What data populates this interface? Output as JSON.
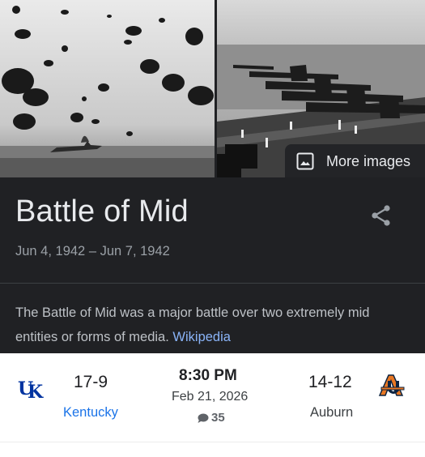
{
  "knowledge_panel": {
    "more_images_label": "More images",
    "title": "Battle of Mid",
    "dates": "Jun 4, 1942 – Jun 7, 1942",
    "description": "The Battle of Mid was a major battle over two extremely mid entities or forms of media.",
    "source_link": "Wikipedia"
  },
  "scorecard": {
    "home": {
      "record": "17-9",
      "name": "Kentucky"
    },
    "away": {
      "record": "14-12",
      "name": "Auburn"
    },
    "time": "8:30 PM",
    "date": "Feb 21, 2026",
    "comments_count": "35"
  },
  "colors": {
    "panel_bg": "#202124",
    "link_blue": "#8ab4f8",
    "kentucky_blue": "#0033a0",
    "auburn_orange": "#e87722",
    "auburn_navy": "#0c2340"
  },
  "icons": [
    "image-icon",
    "share-icon",
    "comment-icon",
    "kentucky-logo",
    "auburn-logo"
  ]
}
